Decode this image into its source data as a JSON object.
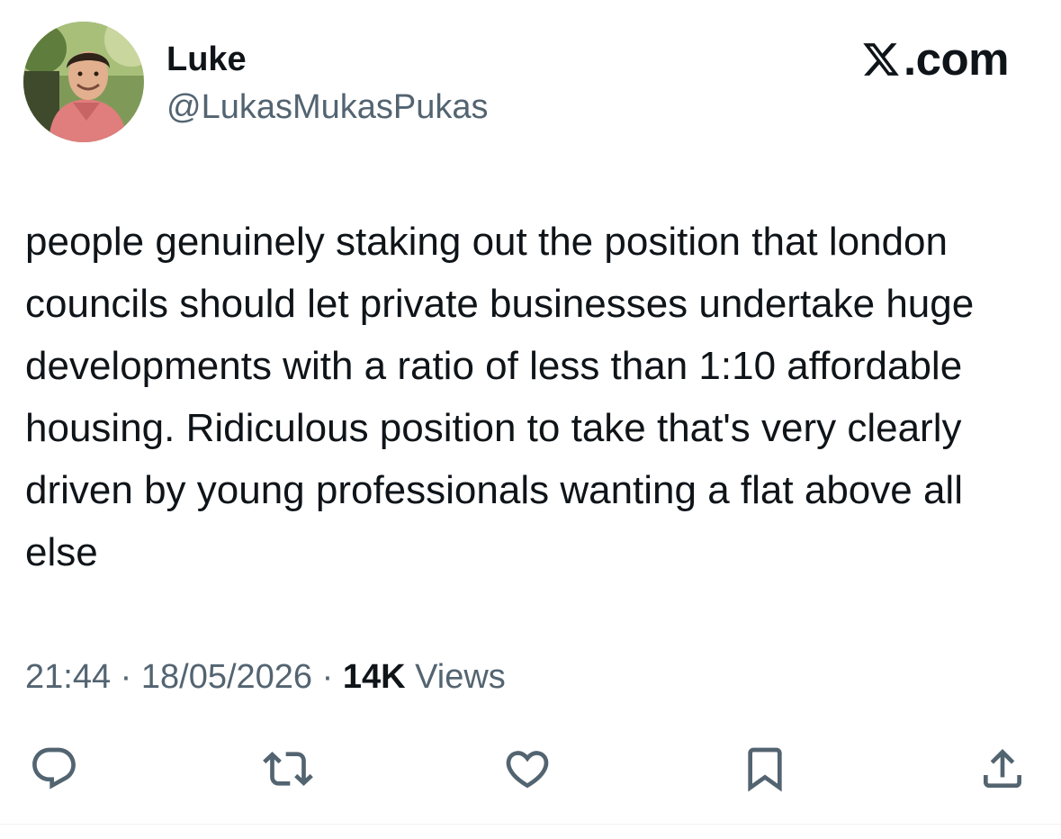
{
  "author": {
    "display_name": "Luke",
    "handle": "@LukasMukasPukas"
  },
  "brand": {
    "logo_icon": "x-logo-icon",
    "text": ".com"
  },
  "tweet": {
    "text": "people genuinely staking out the position that london councils should let private businesses undertake huge developments with a ratio of less than 1:10 affordable housing. Ridiculous position to take that's very clearly driven by young professionals wanting a flat above all else"
  },
  "meta": {
    "time": "21:44",
    "separator": " · ",
    "date": "18/05/2026",
    "views_count": "14K",
    "views_label": " Views"
  },
  "actions": [
    {
      "name": "reply",
      "icon": "reply-icon"
    },
    {
      "name": "retweet",
      "icon": "retweet-icon"
    },
    {
      "name": "like",
      "icon": "heart-icon"
    },
    {
      "name": "bookmark",
      "icon": "bookmark-icon"
    },
    {
      "name": "share",
      "icon": "share-icon"
    }
  ],
  "colors": {
    "text_primary": "#0f1419",
    "text_secondary": "#536471",
    "icon": "#536471",
    "divider": "#eff3f4"
  }
}
